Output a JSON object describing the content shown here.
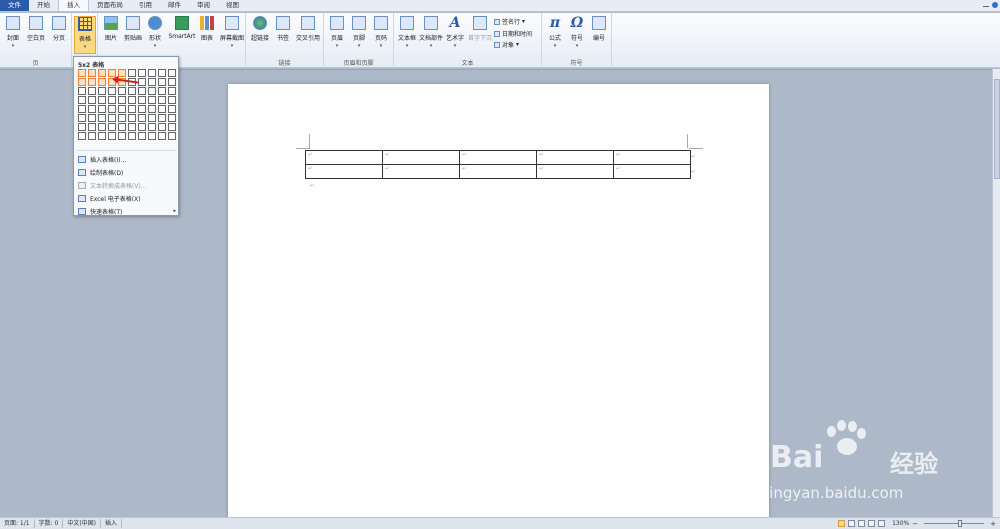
{
  "tabs": [
    "文件",
    "开始",
    "插入",
    "页面布局",
    "引用",
    "邮件",
    "审阅",
    "视图"
  ],
  "ribbon": {
    "pages": {
      "label": "页",
      "cover": "封面",
      "blank": "空白页",
      "break": "分页"
    },
    "tables": {
      "label": "表格"
    },
    "illus": {
      "picture": "图片",
      "clipart": "剪贴画",
      "shapes": "形状",
      "smartart": "SmartArt",
      "chart": "图表",
      "screenshot": "屏幕截图"
    },
    "links": {
      "label": "链接",
      "hyperlink": "超链接",
      "bookmark": "书签",
      "crossref": "交叉引用"
    },
    "hf": {
      "label": "页眉和页脚",
      "header": "页眉",
      "footer": "页脚",
      "pagenum": "页码"
    },
    "text": {
      "label": "文本",
      "textbox": "文本框",
      "quickparts": "文档部件",
      "wordart": "艺术字",
      "dropcap": "首字下沉",
      "sigline": "签名行",
      "datetime": "日期和时间",
      "object": "对象"
    },
    "symbols": {
      "label": "符号",
      "equation": "公式",
      "symbol": "符号",
      "number": "编号"
    }
  },
  "dropdown": {
    "title": "5x2 表格",
    "items": [
      "插入表格(I)...",
      "绘制表格(D)",
      "文本转换成表格(V)...",
      "Excel 电子表格(X)",
      "快速表格(T)"
    ]
  },
  "status": {
    "page": "页面: 1/1",
    "words": "字数: 0",
    "lang": "中文(中国)",
    "mode": "插入",
    "zoom": "130%"
  },
  "watermark": {
    "brand": "Bai",
    "cn": "经验",
    "url": "jingyan.baidu.com"
  },
  "colors": {
    "accent": "#2a5aa8",
    "highlight": "#fbd980",
    "grid_hover": "#f08030"
  }
}
